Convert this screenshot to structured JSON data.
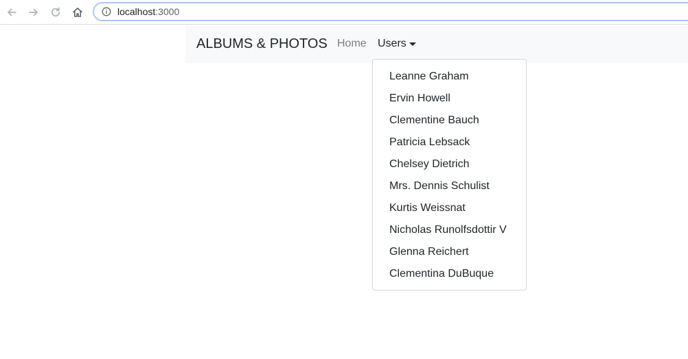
{
  "browser": {
    "url_host": "localhost",
    "url_port": ":3000",
    "icons": {
      "back": "back-arrow-icon",
      "forward": "forward-arrow-icon",
      "reload": "reload-icon",
      "home": "home-icon",
      "info": "info-icon"
    }
  },
  "navbar": {
    "brand": "ALBUMS & PHOTOS",
    "home_label": "Home",
    "users_label": "Users"
  },
  "users_dropdown": {
    "items": [
      "Leanne Graham",
      "Ervin Howell",
      "Clementine Bauch",
      "Patricia Lebsack",
      "Chelsey Dietrich",
      "Mrs. Dennis Schulist",
      "Kurtis Weissnat",
      "Nicholas Runolfsdottir V",
      "Glenna Reichert",
      "Clementina DuBuque"
    ]
  },
  "colors": {
    "navbar_bg": "#f8f9fa",
    "text_primary": "#212529",
    "text_muted": "#7a7d80",
    "address_focus_border": "#a8c7fa"
  }
}
